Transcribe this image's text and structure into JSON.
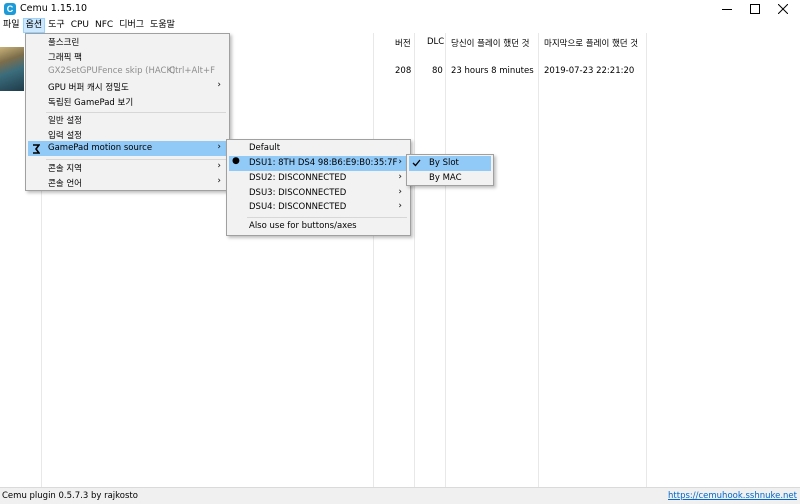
{
  "window": {
    "title": "Cemu 1.15.10",
    "icon_letter": "C"
  },
  "menubar": {
    "items": [
      "파일",
      "옵션",
      "도구",
      "CPU",
      "NFC",
      "디버그",
      "도움말"
    ]
  },
  "table": {
    "headers": {
      "version": "버전",
      "dlc": "DLC",
      "playtime": "당신이 플레이 했던 것",
      "last_played": "마지막으로 플레이 했던 것"
    },
    "rows": [
      {
        "version": "208",
        "dlc": "80",
        "playtime": "23 hours 8 minutes",
        "last_played": "2019-07-23 22:21:20"
      }
    ]
  },
  "options_menu": {
    "fullscreen": "풀스크린",
    "graphic_pack": "그래픽 팩",
    "gx2_fence": "GX2SetGPUFence skip (HACK)",
    "gx2_fence_shortcut": "Ctrl+Alt+F",
    "gpu_cache": "GPU 버퍼 캐시 정밀도",
    "separate_gamepad": "독립된 GamePad 보기",
    "general_settings": "일반 설정",
    "input_settings": "입력 설정",
    "motion_source": "GamePad motion source",
    "console_region": "콘솔 지역",
    "console_language": "콘솔 언어"
  },
  "motion_menu": {
    "default": "Default",
    "dsu1": "DSU1: 8TH DS4 98:B6:E9:B0:35:7F",
    "dsu2": "DSU2: DISCONNECTED",
    "dsu3": "DSU3: DISCONNECTED",
    "dsu4": "DSU4: DISCONNECTED",
    "also_use": "Also use for buttons/axes"
  },
  "slot_menu": {
    "by_slot": "By Slot",
    "by_mac": "By MAC"
  },
  "statusbar": {
    "left": "Cemu plugin 0.5.7.3 by rajkosto",
    "link": "https://cemuhook.sshnuke.net"
  }
}
